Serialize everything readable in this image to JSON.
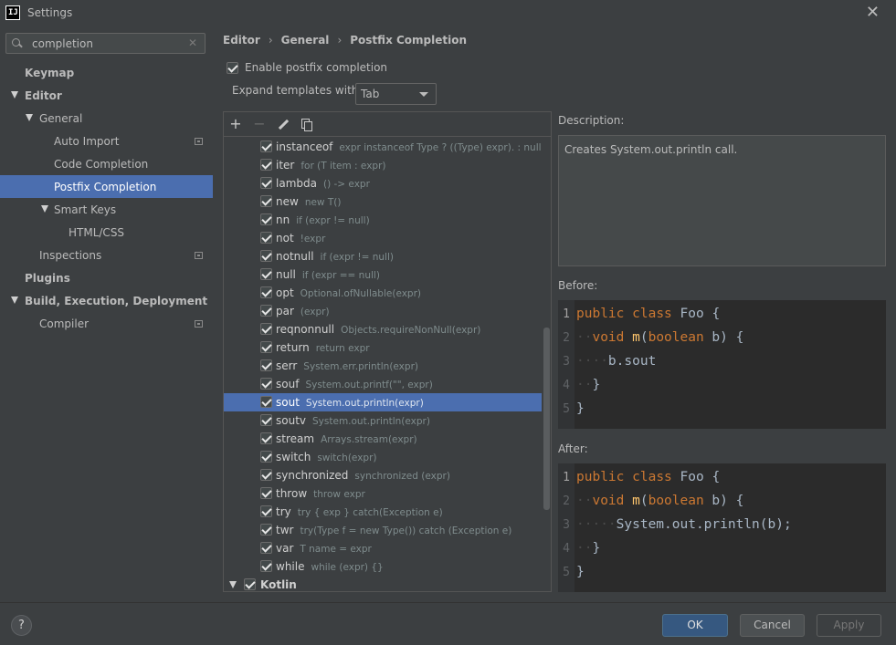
{
  "window": {
    "title": "Settings",
    "app_icon": "IJ"
  },
  "search": {
    "value": "completion",
    "placeholder": ""
  },
  "sidebar": {
    "items": [
      {
        "label": "Keymap"
      },
      {
        "label": "Editor"
      },
      {
        "label": "General"
      },
      {
        "label": "Auto Import"
      },
      {
        "label": "Code Completion"
      },
      {
        "label": "Postfix Completion"
      },
      {
        "label": "Smart Keys"
      },
      {
        "label": "HTML/CSS"
      },
      {
        "label": "Inspections"
      },
      {
        "label": "Plugins"
      },
      {
        "label": "Build, Execution, Deployment"
      },
      {
        "label": "Compiler"
      }
    ]
  },
  "breadcrumb": [
    "Editor",
    "General",
    "Postfix Completion"
  ],
  "enable": {
    "label": "Enable postfix completion",
    "checked": true
  },
  "expand": {
    "label": "Expand templates with",
    "value": "Tab"
  },
  "templates": [
    {
      "key": "instanceof",
      "desc": "expr instanceof Type ? ((Type) expr). : null"
    },
    {
      "key": "iter",
      "desc": "for (T item : expr)"
    },
    {
      "key": "lambda",
      "desc": "() -> expr"
    },
    {
      "key": "new",
      "desc": "new T()"
    },
    {
      "key": "nn",
      "desc": "if (expr != null)"
    },
    {
      "key": "not",
      "desc": "!expr"
    },
    {
      "key": "notnull",
      "desc": "if (expr != null)"
    },
    {
      "key": "null",
      "desc": "if (expr == null)"
    },
    {
      "key": "opt",
      "desc": "Optional.ofNullable(expr)"
    },
    {
      "key": "par",
      "desc": "(expr)"
    },
    {
      "key": "reqnonnull",
      "desc": "Objects.requireNonNull(expr)"
    },
    {
      "key": "return",
      "desc": "return expr"
    },
    {
      "key": "serr",
      "desc": "System.err.println(expr)"
    },
    {
      "key": "souf",
      "desc": "System.out.printf(\"\", expr)"
    },
    {
      "key": "sout",
      "desc": "System.out.println(expr)"
    },
    {
      "key": "soutv",
      "desc": "System.out.println(expr)"
    },
    {
      "key": "stream",
      "desc": "Arrays.stream(expr)"
    },
    {
      "key": "switch",
      "desc": "switch(expr)"
    },
    {
      "key": "synchronized",
      "desc": "synchronized (expr)"
    },
    {
      "key": "throw",
      "desc": "throw expr"
    },
    {
      "key": "try",
      "desc": "try { exp } catch(Exception e)"
    },
    {
      "key": "twr",
      "desc": "try(Type f = new Type()) catch (Exception e)"
    },
    {
      "key": "var",
      "desc": "T name = expr"
    },
    {
      "key": "while",
      "desc": "while (expr) {}"
    }
  ],
  "group": {
    "label": "Kotlin"
  },
  "description": {
    "label": "Description:",
    "text": "Creates System.out.println call."
  },
  "before": {
    "label": "Before:",
    "line_numbers": [
      "1",
      "2",
      "3",
      "4",
      "5"
    ],
    "kw_public": "public",
    "kw_class": "class",
    "class_name": "Foo",
    "brace_open": "{",
    "kw_void": "void",
    "method": "m",
    "kw_boolean": "boolean",
    "params_rest": " b) {",
    "line3": "b.sout",
    "brace_close": "}"
  },
  "after": {
    "label": "After:",
    "line_numbers": [
      "1",
      "2",
      "3",
      "4",
      "5"
    ],
    "line3": "System.out.println(b);"
  },
  "buttons": {
    "help": "?",
    "ok": "OK",
    "cancel": "Cancel",
    "apply": "Apply"
  },
  "colors": {
    "accent": "#4b6eaf",
    "keyword": "#cc7832",
    "function": "#ffc66d",
    "code_text": "#a9b7c6"
  }
}
